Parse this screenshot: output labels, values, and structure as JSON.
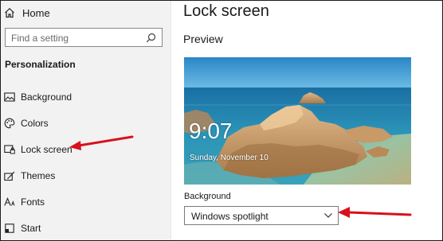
{
  "sidebar": {
    "home_label": "Home",
    "search_placeholder": "Find a setting",
    "section_title": "Personalization",
    "items": [
      {
        "label": "Background",
        "icon": "image-icon"
      },
      {
        "label": "Colors",
        "icon": "palette-icon"
      },
      {
        "label": "Lock screen",
        "icon": "lock-screen-icon"
      },
      {
        "label": "Themes",
        "icon": "brush-icon"
      },
      {
        "label": "Fonts",
        "icon": "font-icon"
      },
      {
        "label": "Start",
        "icon": "start-icon"
      }
    ]
  },
  "main": {
    "title": "Lock screen",
    "preview_label": "Preview",
    "preview": {
      "time": "9:07",
      "date": "Sunday, November 10"
    },
    "background_label": "Background",
    "background_value": "Windows spotlight"
  },
  "annotations": {
    "arrow_color": "#d9111c"
  }
}
